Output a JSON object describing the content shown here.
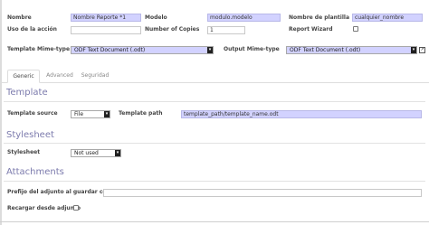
{
  "fields": {
    "nombre": {
      "label": "Nombre",
      "value": "Nombre Reporte *1"
    },
    "modelo": {
      "label": "Modelo",
      "value": "modulo.modelo"
    },
    "nombre_plantilla": {
      "label": "Nombre de plantilla",
      "value": "cualquier_nombre"
    },
    "uso_accion": {
      "label": "Uso de la acción",
      "value": ""
    },
    "number_of_copies": {
      "label": "Number of Copies",
      "value": "1"
    },
    "report_wizard": {
      "label": "Report Wizard",
      "checked": false
    },
    "template_mime_type": {
      "label": "Template Mime-type",
      "value": "ODF Text Document (.odt)"
    },
    "output_mime_type": {
      "label": "Output Mime-type",
      "value": "ODF Text Document (.odt)"
    }
  },
  "tabs": [
    {
      "label": "Generic",
      "active": true
    },
    {
      "label": "Advanced",
      "active": false
    },
    {
      "label": "Seguridad",
      "active": false
    }
  ],
  "template_section": {
    "title": "Template",
    "source_label": "Template source",
    "source_value": "File",
    "path_label": "Template path",
    "path_value": "template_path/template_name.odt"
  },
  "stylesheet_section": {
    "title": "Stylesheet",
    "label": "Stylesheet",
    "value": "Not used"
  },
  "attachments_section": {
    "title": "Attachments",
    "prefix_label": "Prefijo del adjunto al guardar como",
    "prefix_value": "",
    "reload_label": "Recargar desde adjunto",
    "reload_checked": false
  },
  "icons": {
    "dropdown": "triangle-down-icon",
    "external_link": "external-link-icon"
  },
  "colors": {
    "required_field": "#d2d2ff",
    "section_title": "#7c7bad"
  }
}
